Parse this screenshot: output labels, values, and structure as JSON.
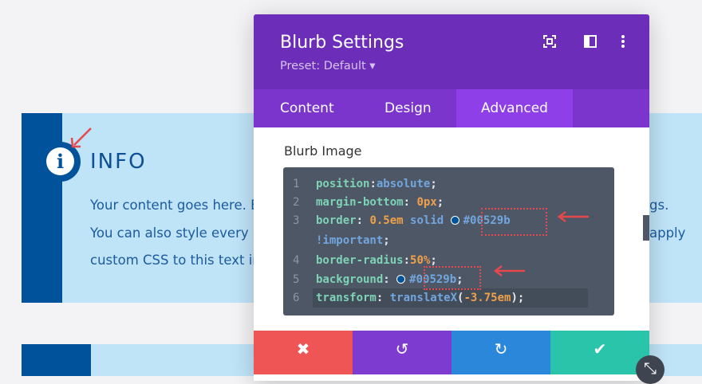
{
  "blurb": {
    "title": "INFO",
    "lines_left": [
      "Your content goes here. E",
      "You can also style every a",
      "custom CSS to this text in"
    ],
    "lines_right": [
      "gs.",
      "apply"
    ]
  },
  "modal": {
    "title": "Blurb Settings",
    "preset": "Preset: Default ▾",
    "icons": [
      "focus-icon",
      "split-view-icon",
      "more-options-icon"
    ],
    "tabs": [
      {
        "label": "Content"
      },
      {
        "label": "Design"
      },
      {
        "label": "Advanced",
        "active": true
      }
    ],
    "section_title": "Blurb Image",
    "code": [
      {
        "num": "1",
        "prop": "position",
        "sep": ":",
        "value": "absolute",
        "end": ";"
      },
      {
        "num": "2",
        "prop": "margin-bottom",
        "sep": ": ",
        "value": "0px",
        "end": ";"
      },
      {
        "num": "3",
        "prop": "border",
        "sep": ": ",
        "value": "0.5em",
        "value2": "solid",
        "color": "#00529b"
      },
      {
        "num": "",
        "value": "!important",
        "end": ";"
      },
      {
        "num": "4",
        "prop": "border-radius",
        "sep": ":",
        "value": "50%",
        "end": ";"
      },
      {
        "num": "5",
        "prop": "background",
        "sep": ": ",
        "color": "#00529b",
        "end": ";"
      },
      {
        "num": "6",
        "prop": "transform",
        "sep": ": ",
        "fn": "translateX",
        "value": "-3.75em",
        "end": ");"
      }
    ],
    "footer": {
      "cancel": "✖",
      "undo": "↺",
      "redo": "↻",
      "save": "✔"
    }
  },
  "colors": {
    "brand_dark": "#00529b",
    "modal_purple": "#6c2eb9",
    "tab_purple": "#7b35cc",
    "active_tab": "#8e3fe8",
    "cancel": "#ef5555",
    "undo": "#7d3bcf",
    "redo": "#2b87da",
    "save": "#29c4a9"
  }
}
